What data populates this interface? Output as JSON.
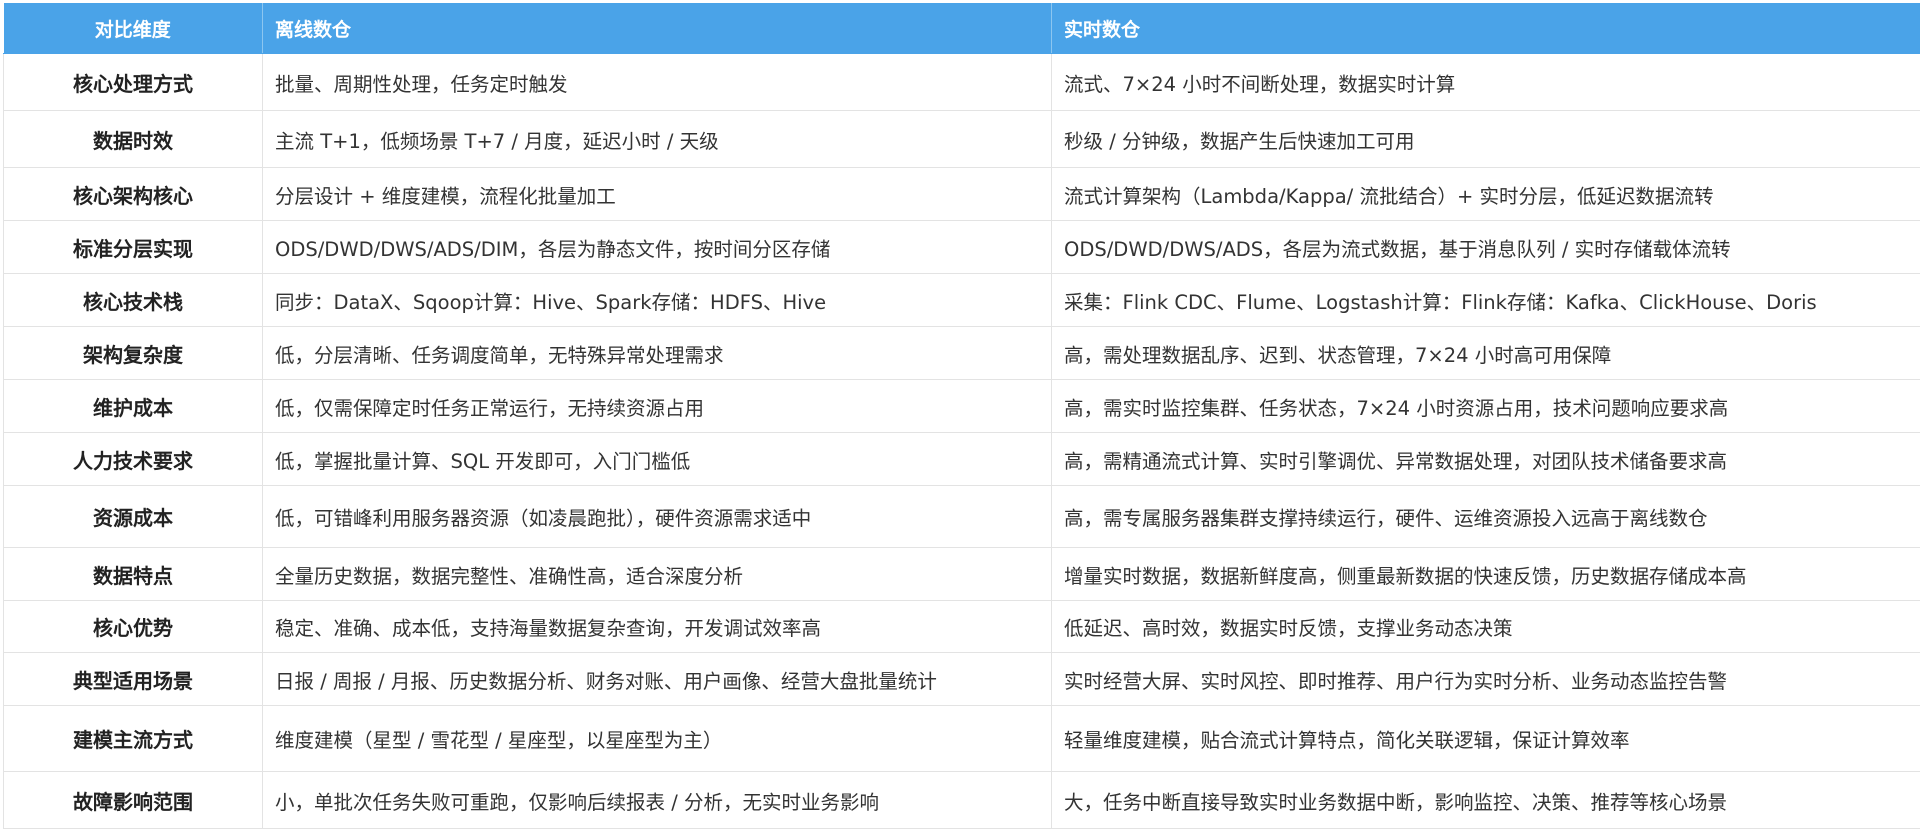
{
  "header": {
    "dimension": "对比维度",
    "offline": "离线数仓",
    "realtime": "实时数仓"
  },
  "rows": [
    {
      "dimension": "核心处理方式",
      "offline": "批量、周期性处理，任务定时触发",
      "realtime": "流式、7×24 小时不间断处理，数据实时计算"
    },
    {
      "dimension": "数据时效",
      "offline": "主流 T+1，低频场景 T+7 / 月度，延迟小时 / 天级",
      "realtime": "秒级 / 分钟级，数据产生后快速加工可用"
    },
    {
      "dimension": "核心架构核心",
      "offline": "分层设计 + 维度建模，流程化批量加工",
      "realtime": "流式计算架构（Lambda/Kappa/ 流批结合）+ 实时分层，低延迟数据流转"
    },
    {
      "dimension": "标准分层实现",
      "offline": "ODS/DWD/DWS/ADS/DIM，各层为静态文件，按时间分区存储",
      "realtime": "ODS/DWD/DWS/ADS，各层为流式数据，基于消息队列 / 实时存储载体流转"
    },
    {
      "dimension": "核心技术栈",
      "offline": "同步：DataX、Sqoop计算：Hive、Spark存储：HDFS、Hive",
      "realtime": "采集：Flink CDC、Flume、Logstash计算：Flink存储：Kafka、ClickHouse、Doris"
    },
    {
      "dimension": "架构复杂度",
      "offline": "低，分层清晰、任务调度简单，无特殊异常处理需求",
      "realtime": "高，需处理数据乱序、迟到、状态管理，7×24 小时高可用保障"
    },
    {
      "dimension": "维护成本",
      "offline": "低，仅需保障定时任务正常运行，无持续资源占用",
      "realtime": "高，需实时监控集群、任务状态，7×24 小时资源占用，技术问题响应要求高"
    },
    {
      "dimension": "人力技术要求",
      "offline": "低，掌握批量计算、SQL 开发即可，入门门槛低",
      "realtime": "高，需精通流式计算、实时引擎调优、异常数据处理，对团队技术储备要求高"
    },
    {
      "dimension": "资源成本",
      "offline": "低，可错峰利用服务器资源（如凌晨跑批），硬件资源需求适中",
      "realtime": "高，需专属服务器集群支撑持续运行，硬件、运维资源投入远高于离线数仓"
    },
    {
      "dimension": "数据特点",
      "offline": "全量历史数据，数据完整性、准确性高，适合深度分析",
      "realtime": "增量实时数据，数据新鲜度高，侧重最新数据的快速反馈，历史数据存储成本高"
    },
    {
      "dimension": "核心优势",
      "offline": "稳定、准确、成本低，支持海量数据复杂查询，开发调试效率高",
      "realtime": "低延迟、高时效，数据实时反馈，支撑业务动态决策"
    },
    {
      "dimension": "典型适用场景",
      "offline": "日报 / 周报 / 月报、历史数据分析、财务对账、用户画像、经营大盘批量统计",
      "realtime": "实时经营大屏、实时风控、即时推荐、用户行为实时分析、业务动态监控告警"
    },
    {
      "dimension": "建模主流方式",
      "offline": "维度建模（星型 / 雪花型 / 星座型，以星座型为主）",
      "realtime": "轻量维度建模，贴合流式计算特点，简化关联逻辑，保证计算效率"
    },
    {
      "dimension": "故障影响范围",
      "offline": "小，单批次任务失败可重跑，仅影响后续报表 / 分析，无实时业务影响",
      "realtime": "大，任务中断直接导致实时业务数据中断，影响监控、决策、推荐等核心场景"
    }
  ],
  "colors": {
    "header_bg": "#4aa3e8",
    "header_text": "#ffffff",
    "border": "#e3e3e3",
    "text": "#333333"
  }
}
